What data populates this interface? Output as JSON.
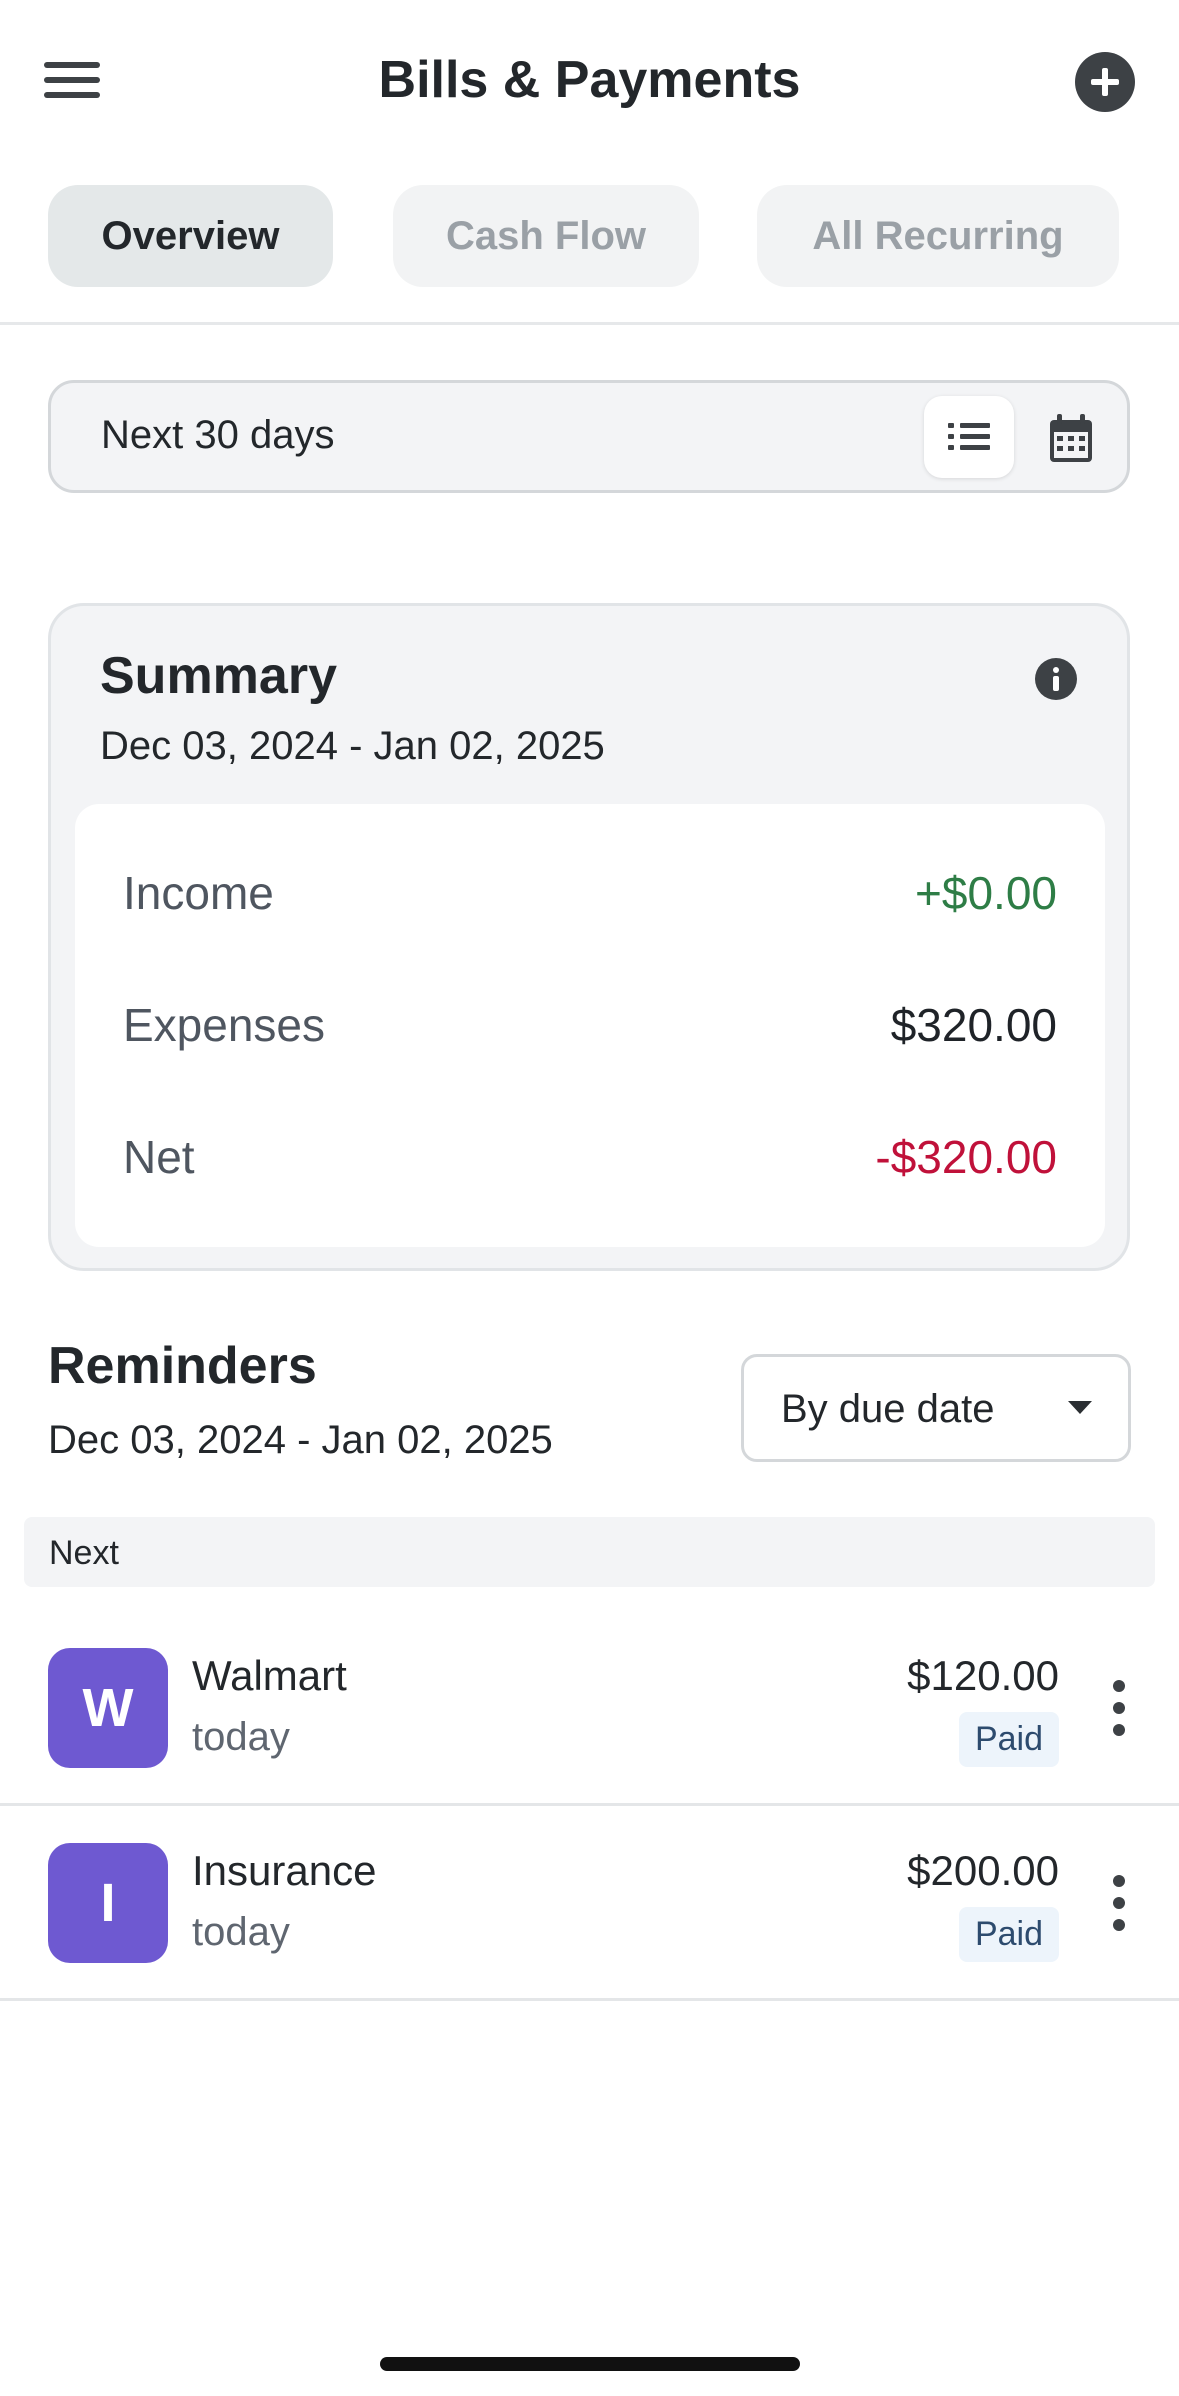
{
  "header": {
    "title": "Bills & Payments",
    "menu_icon": "hamburger-menu-icon",
    "add_icon": "plus-circle-icon"
  },
  "tabs": [
    {
      "label": "Overview",
      "active": true
    },
    {
      "label": "Cash Flow",
      "active": false
    },
    {
      "label": "All Recurring",
      "active": false
    }
  ],
  "range_selector": {
    "label": "Next 30 days",
    "list_view_icon": "list-icon",
    "calendar_view_icon": "calendar-icon",
    "selected_view": "list"
  },
  "summary": {
    "title": "Summary",
    "date_range": "Dec 03, 2024 - Jan 02, 2025",
    "info_icon": "info-icon",
    "rows": [
      {
        "label": "Income",
        "value": "+$0.00",
        "color": "#2e7d46"
      },
      {
        "label": "Expenses",
        "value": "$320.00",
        "color": "#1f2328"
      },
      {
        "label": "Net",
        "value": "-$320.00",
        "color": "#c0113a"
      }
    ]
  },
  "reminders": {
    "title": "Reminders",
    "date_range": "Dec 03, 2024 - Jan 02, 2025",
    "sort_label": "By due date",
    "group_label": "Next",
    "items": [
      {
        "initial": "W",
        "name": "Walmart",
        "due": "today",
        "amount": "$120.00",
        "status": "Paid"
      },
      {
        "initial": "I",
        "name": "Insurance",
        "due": "today",
        "amount": "$200.00",
        "status": "Paid"
      }
    ]
  },
  "colors": {
    "avatar": "#6e59d1",
    "income": "#2e7d46",
    "net_negative": "#c0113a",
    "badge_bg": "#edf4fb"
  }
}
